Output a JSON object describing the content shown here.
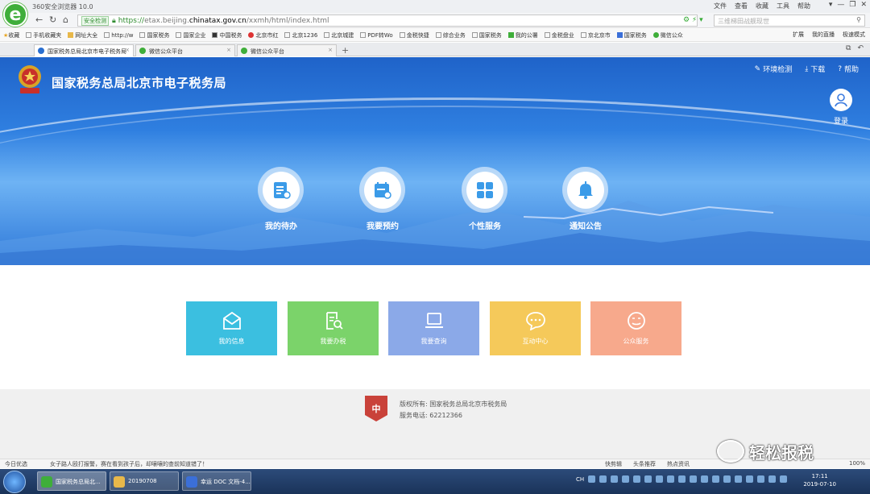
{
  "browser": {
    "title": "360安全浏览器 10.0",
    "menu": [
      "文件",
      "查看",
      "收藏",
      "工具",
      "帮助"
    ],
    "url_security_label": "安全检测",
    "url_protocol": "https://",
    "url_domain_pre": "etax.beijing.",
    "url_domain_main": "chinatax.gov.cn",
    "url_path": "/xxmh/html/index.html",
    "search_placeholder": "三维梯田战舰现世",
    "bookmarks": [
      "收藏",
      "手机收藏夹",
      "网址大全",
      "http://w",
      "国家税务",
      "国家企业",
      "中国税务",
      "北京市红",
      "北京1236",
      "北京城建",
      "PDF转Wo",
      "金税快捷",
      "综合业务",
      "国家税务",
      "我的公署",
      "金税盘业",
      "京北京市",
      "国家税务",
      "微信公众"
    ],
    "bookmarks_right": [
      "扩展",
      "我的直播",
      "极速模式"
    ],
    "tabs": [
      {
        "label": "国家税务总局北京市电子税务局",
        "color": "#2a6fd0"
      },
      {
        "label": "微信公众平台",
        "color": "#3fae3a"
      },
      {
        "label": "微信公众平台",
        "color": "#3fae3a"
      }
    ]
  },
  "site": {
    "title": "国家税务总局北京市电子税务局",
    "links": [
      "环境检测",
      "下载",
      "帮助"
    ],
    "login": "登录",
    "quick": [
      {
        "label": "我的待办",
        "icon": "todo-icon"
      },
      {
        "label": "我要预约",
        "icon": "calendar-icon"
      },
      {
        "label": "个性服务",
        "icon": "grid-icon"
      },
      {
        "label": "通知公告",
        "icon": "bell-icon"
      }
    ],
    "tiles": [
      {
        "label": "我的信息",
        "icon": "envelope-icon",
        "color": "#3bbfe0"
      },
      {
        "label": "我要办税",
        "icon": "document-search-icon",
        "color": "#7bd36a"
      },
      {
        "label": "我要查询",
        "icon": "laptop-icon",
        "color": "#8ba9e8"
      },
      {
        "label": "互动中心",
        "icon": "chat-icon",
        "color": "#f5c95a"
      },
      {
        "label": "公众服务",
        "icon": "smile-icon",
        "color": "#f7a98c"
      }
    ],
    "footer": {
      "copyright": "版权所有: 国家税务总局北京市税务局",
      "phone": "服务电话: 62212366"
    }
  },
  "statusbar": {
    "left": "今日优选",
    "news": "女子路人殴打报警，赛在看到孩子后，却嚷嚷的查前知道错了！",
    "right": [
      "快剪辑",
      "头条推荐",
      "热点资讯"
    ],
    "zoom": "100%"
  },
  "taskbar": {
    "items": [
      {
        "label": "国家税务总局北...",
        "color": "#3fae3a"
      },
      {
        "label": "20190708",
        "color": "#e8b84a"
      },
      {
        "label": "幸运 DOC 文档-4...",
        "color": "#3b6fd8"
      }
    ],
    "lang": "CH",
    "time": "17:11",
    "date": "2019-07-10"
  },
  "watermark": "轻松报税"
}
